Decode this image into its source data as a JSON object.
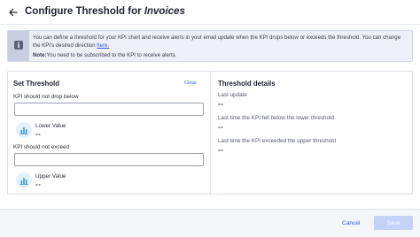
{
  "header": {
    "title_prefix": "Configure Threshold for ",
    "title_subject": "Invoices"
  },
  "info_banner": {
    "text": "You can define a threshold for your KPI chart and receive alerts in your email update when the KPI drops below or exceeds the threshold. You can change the KPI's desired direction ",
    "link_text": "here.",
    "note_label": "Note:",
    "note_text": "You need to be subscribed to the KPI to receive alerts.",
    "icon": "info-icon"
  },
  "set_threshold": {
    "title": "Set Threshold",
    "clear_label": "Clear",
    "lower_field_label": "KPI should not drop below",
    "lower_field_value": "",
    "lower_value_label": "Lower Value",
    "lower_value": "--",
    "upper_field_label": "KPI should not exceed",
    "upper_field_value": "",
    "upper_value_label": "Upper Value",
    "upper_value": "--",
    "value_icon": "bar-chart-icon"
  },
  "threshold_details": {
    "title": "Threshold details",
    "items": [
      {
        "label": "Last update",
        "value": "--"
      },
      {
        "label": "Last time the KPI fell below the lower threshold",
        "value": "--"
      },
      {
        "label": "Last time the KPI exceeded the upper threshold",
        "value": "--"
      }
    ]
  },
  "footer": {
    "cancel_label": "Cancel",
    "save_label": "Save"
  },
  "colors": {
    "link": "#2f5bd6",
    "save_disabled": "#c3d3f7",
    "info_background": "#eef0f8",
    "icon_circle": "#e3f2fb"
  }
}
